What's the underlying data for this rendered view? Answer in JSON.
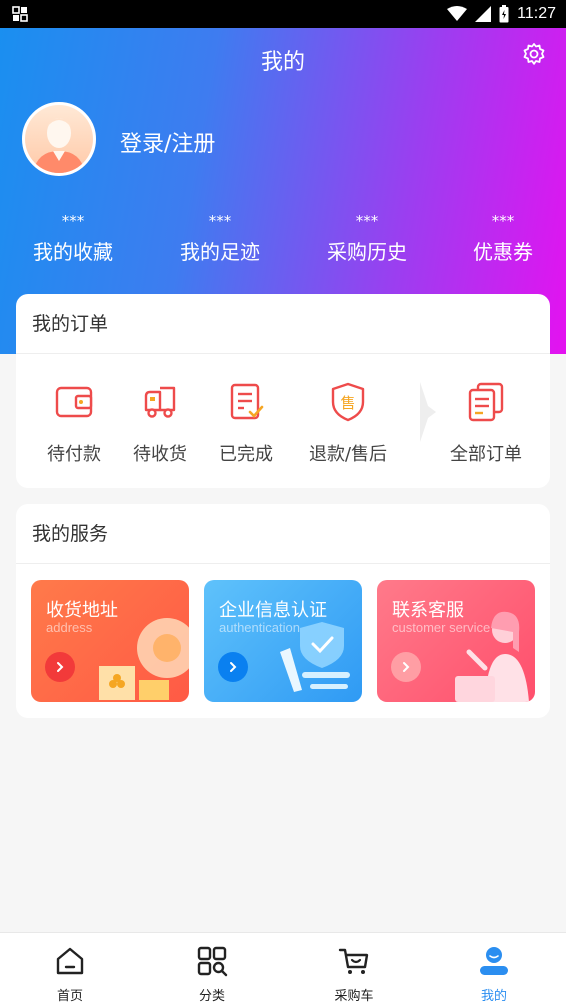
{
  "status_bar": {
    "time": "11:27"
  },
  "header": {
    "title": "我的",
    "login_text": "登录/注册",
    "stats": [
      {
        "value": "***",
        "label": "我的收藏"
      },
      {
        "value": "***",
        "label": "我的足迹"
      },
      {
        "value": "***",
        "label": "采购历史"
      },
      {
        "value": "***",
        "label": "优惠券"
      }
    ]
  },
  "orders": {
    "title": "我的订单",
    "items": [
      {
        "label": "待付款",
        "icon": "wallet-icon"
      },
      {
        "label": "待收货",
        "icon": "truck-icon"
      },
      {
        "label": "已完成",
        "icon": "completed-doc-icon"
      },
      {
        "label": "退款/售后",
        "icon": "after-sale-shield-icon"
      },
      {
        "label": "全部订单",
        "icon": "all-orders-icon"
      }
    ]
  },
  "services": {
    "title": "我的服务",
    "items": [
      {
        "title": "收货地址",
        "subtitle": "address",
        "color": "#ff6a4a"
      },
      {
        "title": "企业信息认证",
        "subtitle": "authentication",
        "color": "#3aa8f5"
      },
      {
        "title": "联系客服",
        "subtitle": "customer service",
        "color": "#ff5c78"
      }
    ]
  },
  "tabbar": {
    "items": [
      {
        "label": "首页",
        "icon": "home-icon",
        "active": false
      },
      {
        "label": "分类",
        "icon": "category-icon",
        "active": false
      },
      {
        "label": "采购车",
        "icon": "cart-icon",
        "active": false
      },
      {
        "label": "我的",
        "icon": "profile-icon",
        "active": true
      }
    ],
    "active_color": "#2b8ef0"
  }
}
